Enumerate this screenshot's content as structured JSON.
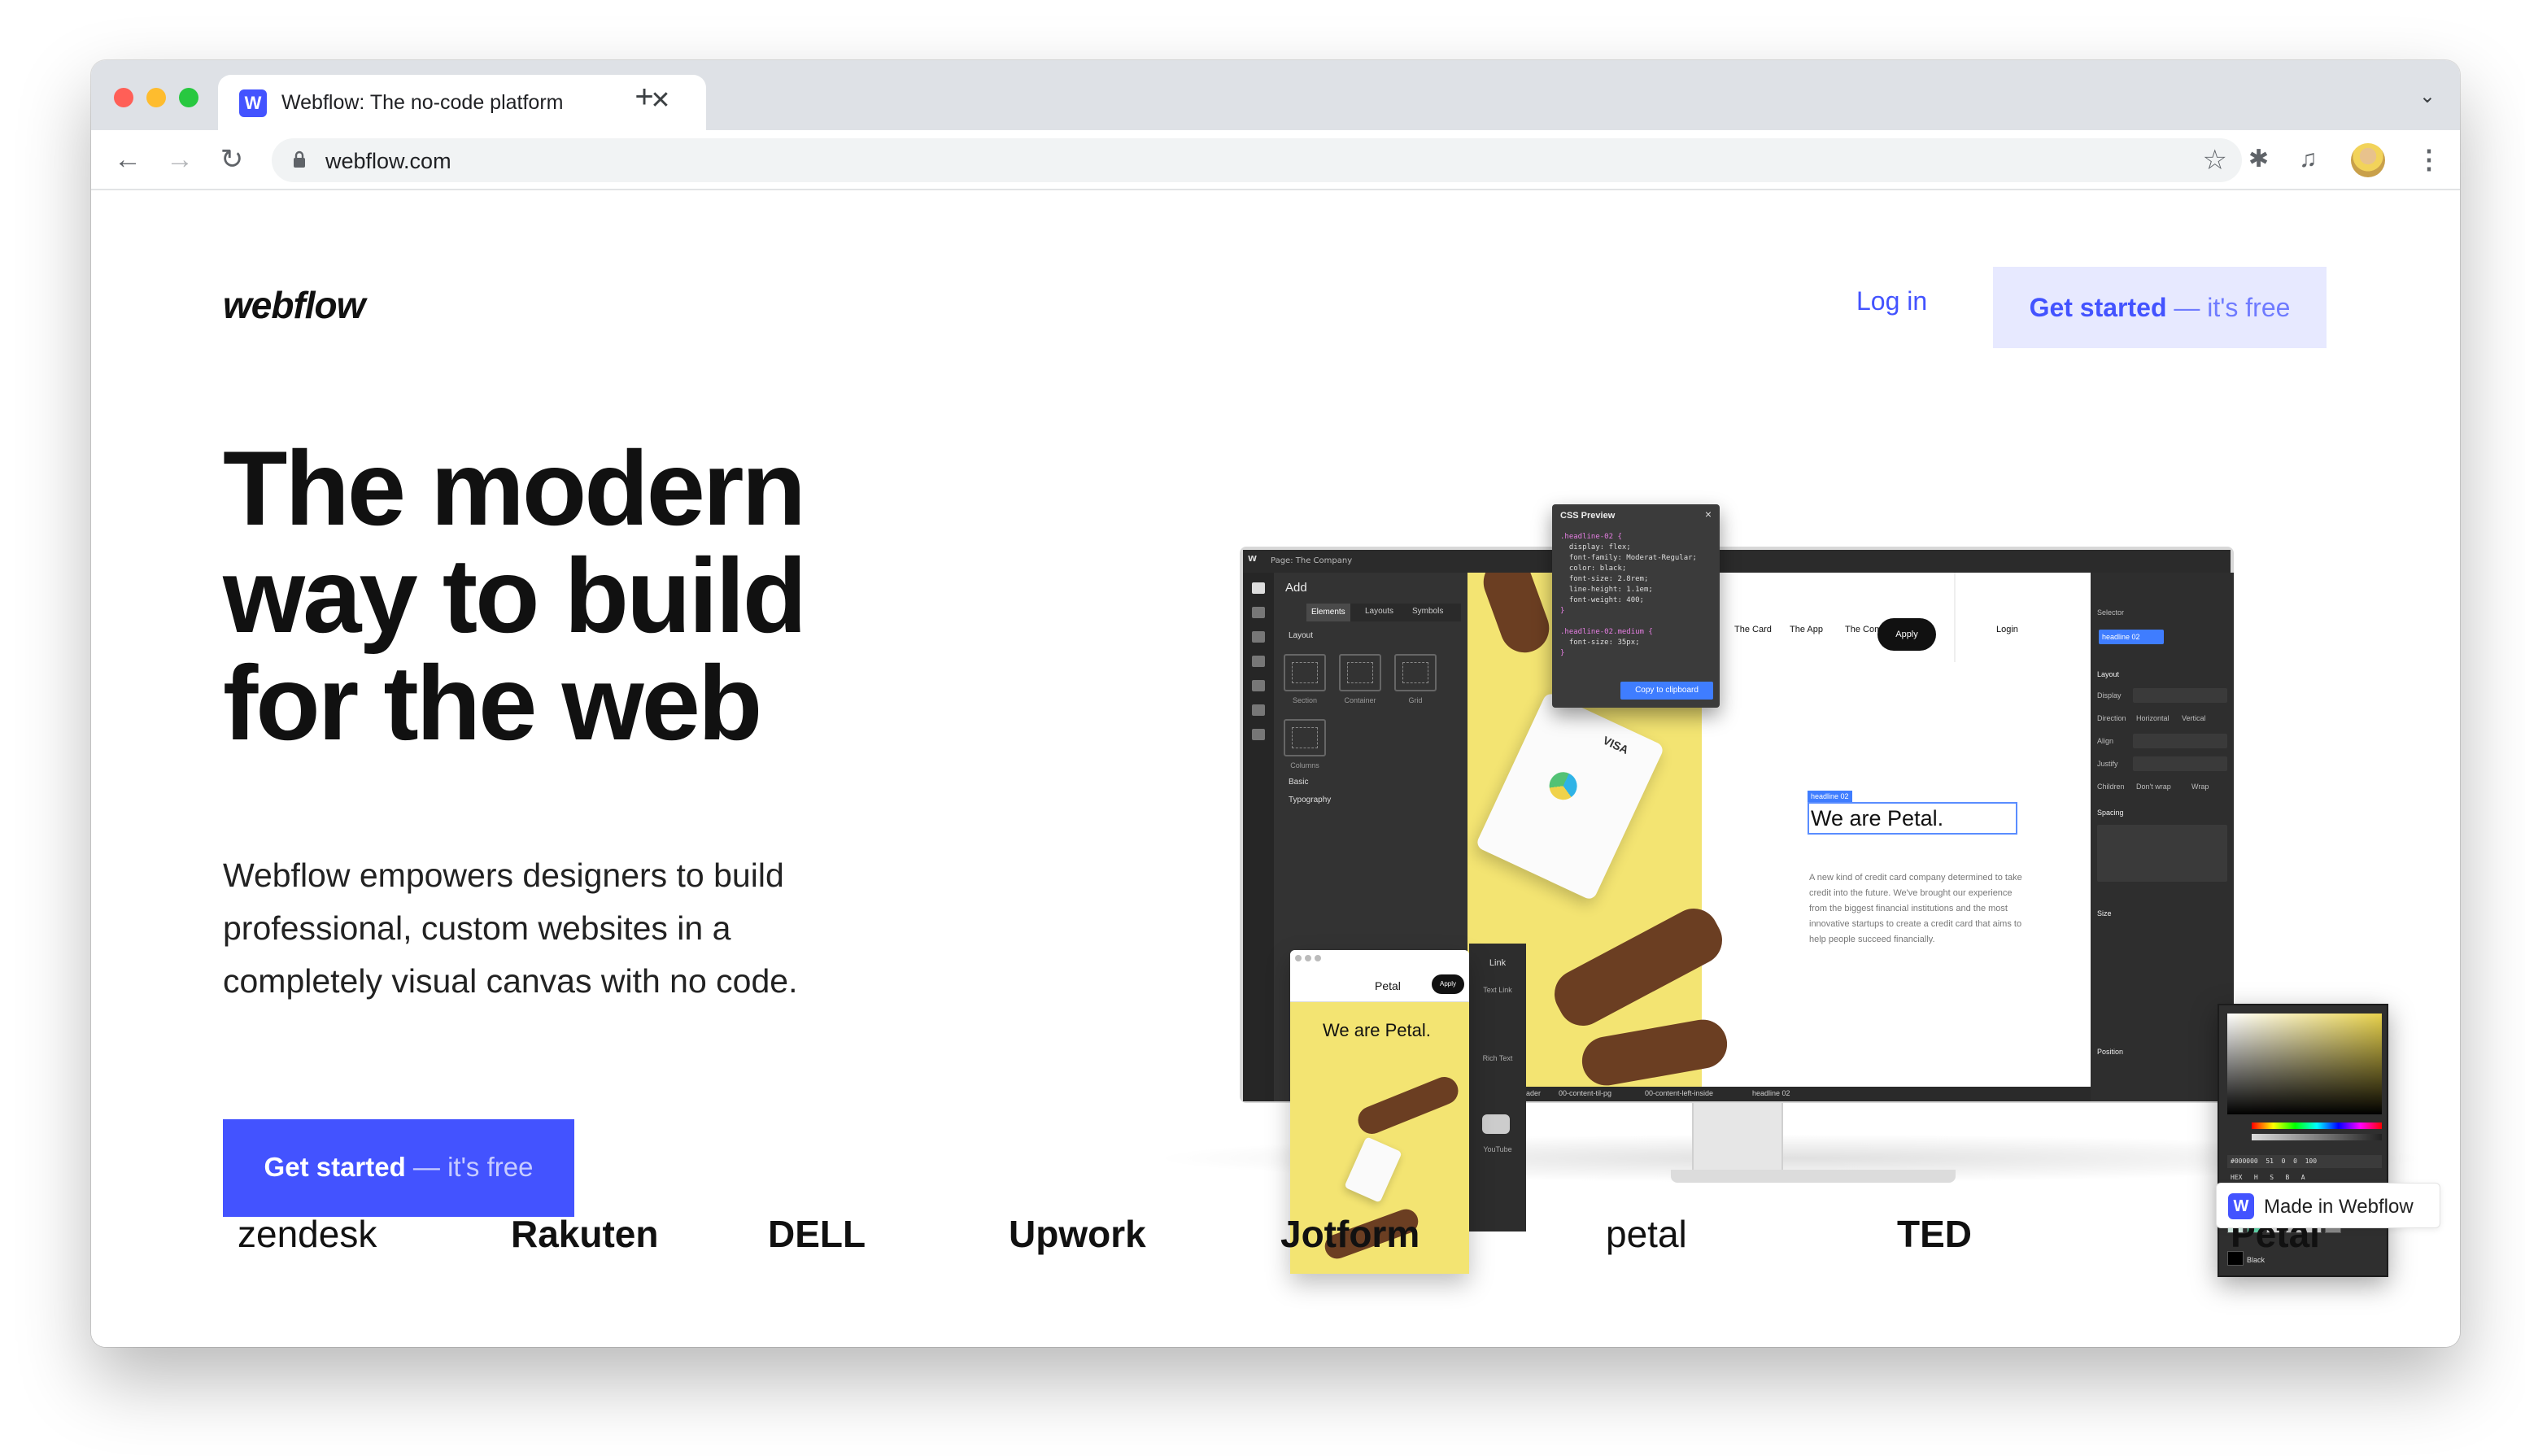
{
  "browser": {
    "tab_title": "Webflow: The no-code platform",
    "tab_favicon": "W",
    "tab_close": "✕",
    "new_tab": "+",
    "tab_menu": "⌄",
    "url": "webflow.com",
    "nav_back": "←",
    "nav_forward": "→",
    "nav_reload": "↻",
    "bookmark": "☆",
    "extensions": "✱",
    "media": "♫",
    "menu": "⋮"
  },
  "header": {
    "logo": "webflow",
    "login": "Log in",
    "cta_strong": "Get started",
    "cta_light": " — it's free"
  },
  "hero": {
    "title_lines": [
      "The modern",
      "way to build",
      "for the web"
    ],
    "subtitle": "Webflow empowers designers to build professional, custom websites in a completely visual canvas with no code.",
    "cta_strong": "Get started",
    "cta_light": " — it's free"
  },
  "designer": {
    "page_label": "Page: The Company",
    "add_panel": {
      "title": "Add",
      "tabs": [
        "Elements",
        "Layouts",
        "Symbols"
      ],
      "layout_label": "Layout",
      "elements": [
        "Section",
        "Container",
        "Grid",
        "Columns"
      ],
      "basic_label": "Basic",
      "typography_label": "Typography"
    },
    "canvas": {
      "nav": [
        "The Card",
        "The App",
        "The Company"
      ],
      "apply": "Apply",
      "login": "Login",
      "heading_badge": "headline 02",
      "heading": "We are Petal.",
      "paragraph": "A new kind of credit card company determined to take credit into the future. We've brought our experience from the biggest financial institutions and the most innovative startups to create a credit card that aims to help people succeed financially.",
      "card_brand": "VISA",
      "breadcrumbs": [
        "00-half-in-half-header",
        "00-content-til-pg",
        "00-content-left-inside",
        "headline 02"
      ]
    },
    "css_preview": {
      "title": "CSS Preview",
      "code_lines": [
        ".headline-02 {",
        "  display: flex;",
        "  font-family: Moderat-Regular;",
        "  color: black;",
        "  font-size: 2.8rem;",
        "  line-height: 1.1em;",
        "  font-weight: 400;",
        "}",
        "",
        ".headline-02.medium {",
        "  font-size: 35px;",
        "}"
      ],
      "button": "Copy to clipboard"
    },
    "style_panel": {
      "selector_label": "Selector",
      "selector_value": "headline 02",
      "sections": [
        "Layout",
        "Spacing",
        "Size",
        "Position"
      ],
      "rows": [
        "Display",
        "Direction",
        "Align",
        "Justify",
        "Children"
      ],
      "direction_values": [
        "Horizontal",
        "Vertical"
      ],
      "children_values": [
        "Don't wrap",
        "Wrap"
      ]
    },
    "mobile": {
      "brand": "Petal",
      "apply": "Apply",
      "heading": "We are Petal."
    },
    "tiles": [
      "Link",
      "Text Link",
      "Rich Text",
      "YouTube"
    ],
    "color_picker": {
      "hex": "#000000",
      "hex_values": [
        "51",
        "0",
        "0",
        "100"
      ],
      "modes": [
        "HEX",
        "H",
        "S",
        "B",
        "A"
      ],
      "color_name": "Black"
    }
  },
  "logos": [
    "zendesk",
    "Rakuten",
    "DELL",
    "Upwork",
    "Jotform",
    "petal",
    "TED",
    "Petal"
  ],
  "badge": {
    "icon": "W",
    "text": "Made in Webflow"
  },
  "colors": {
    "brand": "#4353ff",
    "cta_bg_light": "#e7e9ff",
    "photo_yellow": "#f3e472"
  }
}
